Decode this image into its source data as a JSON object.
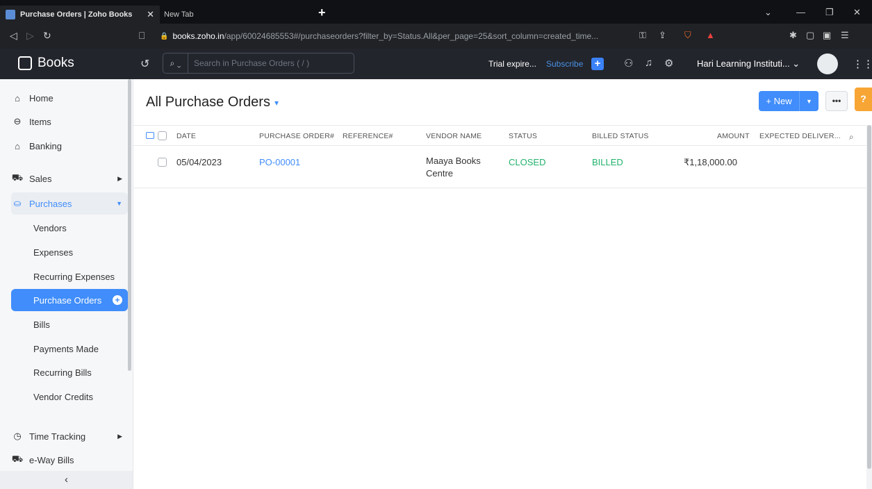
{
  "browser": {
    "tabs": [
      {
        "label": "Purchase Orders | Zoho Books",
        "close": "✕"
      },
      {
        "label": "New Tab"
      }
    ],
    "new_tab": "+",
    "url_host": "books.zoho.in",
    "url_path": "/app/60024685553#/purchaseorders?filter_by=Status.All&per_page=25&sort_column=created_time..."
  },
  "app": {
    "name": "Books",
    "search_placeholder": "Search in Purchase Orders ( / )",
    "trial": "Trial expire...",
    "subscribe": "Subscribe",
    "org": "Hari Learning Instituti... ⌄"
  },
  "sidebar": {
    "items": [
      {
        "label": "Home",
        "icon": "home-icon"
      },
      {
        "label": "Items",
        "icon": "items-icon"
      },
      {
        "label": "Banking",
        "icon": "bank-icon"
      },
      {
        "label": "Sales",
        "icon": "cart-icon"
      },
      {
        "label": "Purchases",
        "icon": "bag-icon"
      },
      {
        "label": "Vendors"
      },
      {
        "label": "Expenses"
      },
      {
        "label": "Recurring Expenses"
      },
      {
        "label": "Purchase Orders"
      },
      {
        "label": "Bills"
      },
      {
        "label": "Payments Made"
      },
      {
        "label": "Recurring Bills"
      },
      {
        "label": "Vendor Credits"
      },
      {
        "label": "Time Tracking",
        "icon": "clock-icon"
      },
      {
        "label": "e-Way Bills",
        "icon": "truck-icon"
      }
    ],
    "collapse": "‹"
  },
  "main": {
    "title": "All Purchase Orders",
    "new_label": "+ New",
    "more_label": "•••",
    "help_label": "?",
    "columns": [
      "DATE",
      "PURCHASE ORDER#",
      "REFERENCE#",
      "VENDOR NAME",
      "STATUS",
      "BILLED STATUS",
      "AMOUNT",
      "EXPECTED DELIVER..."
    ],
    "rows": [
      {
        "date": "05/04/2023",
        "po": "PO-00001",
        "reference": "",
        "vendor": "Maaya Books Centre",
        "status": "CLOSED",
        "billed": "BILLED",
        "amount": "₹1,18,000.00",
        "expected": ""
      }
    ]
  },
  "colors": {
    "accent": "#408dfb",
    "success": "#21b26b",
    "header_bg": "#22252c",
    "help": "#f7a534"
  }
}
